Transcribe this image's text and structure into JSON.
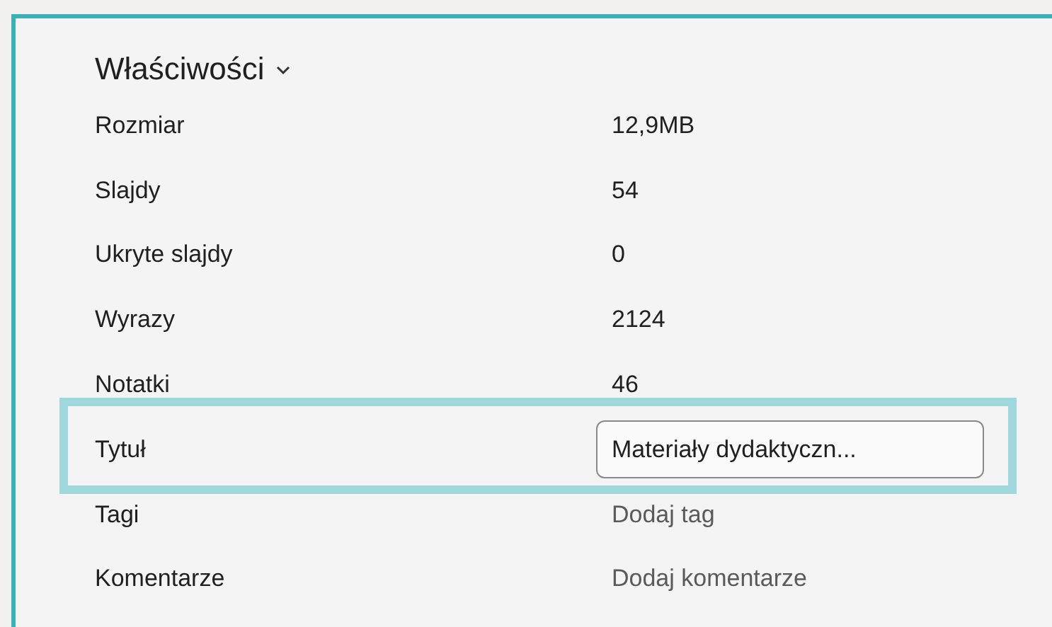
{
  "section": {
    "title": "Właściwości",
    "expanded": true
  },
  "properties": [
    {
      "label": "Rozmiar",
      "kind": "text",
      "value": "12,9MB",
      "highlighted": false
    },
    {
      "label": "Slajdy",
      "kind": "text",
      "value": "54",
      "highlighted": false
    },
    {
      "label": "Ukryte slajdy",
      "kind": "text",
      "value": "0",
      "highlighted": false
    },
    {
      "label": "Wyrazy",
      "kind": "text",
      "value": "2124",
      "highlighted": false
    },
    {
      "label": "Notatki",
      "kind": "text",
      "value": "46",
      "highlighted": false
    },
    {
      "label": "Tytuł",
      "kind": "field",
      "value": "Materiały dydaktyczn...",
      "highlighted": true
    },
    {
      "label": "Tagi",
      "kind": "action",
      "value": "Dodaj tag",
      "highlighted": false
    },
    {
      "label": "Komentarze",
      "kind": "action",
      "value": "Dodaj komentarze",
      "highlighted": false
    }
  ]
}
